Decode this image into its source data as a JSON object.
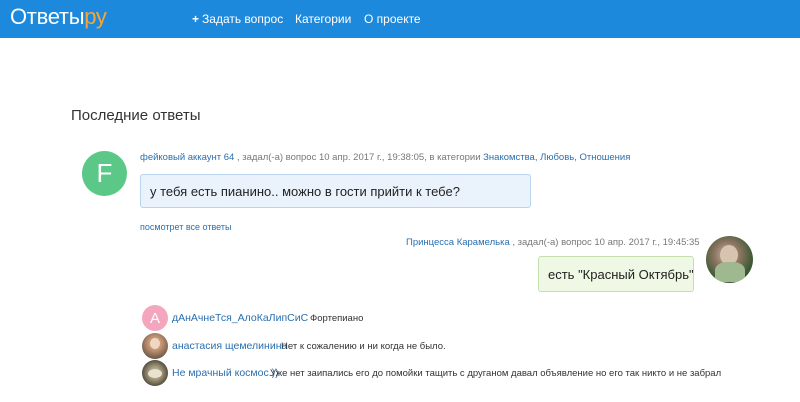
{
  "navbar": {
    "logo_main": "Ответы",
    "logo_accent": "ру",
    "ask_label": "Задать вопрос",
    "categories_label": "Категории",
    "about_label": "О проекте"
  },
  "section_title": "Последние ответы",
  "question": {
    "avatar_letter": "F",
    "author": "фейковый аккаунт 64",
    "meta_text": ", задал(-а) вопрос 10 апр. 2017 г., 19:38:05, в категории",
    "category_1": "Знакомства, Любовь, Отношения",
    "text": "у тебя есть пианино.. можно в гости прийти к тебе?",
    "see_all": "посмотрет все ответы"
  },
  "answer": {
    "author": "Принцесса Карамелька",
    "meta_text": ", задал(-а) вопрос 10 апр. 2017 г., 19:45:35",
    "text": "есть \"Красный Октябрь\""
  },
  "replies": [
    {
      "avatar_letter": "А",
      "user": "дАнАчнеТся_АлоКаЛипСиС",
      "text": "Фортепиано"
    },
    {
      "avatar_letter": "",
      "user": "анастасия щемелинина",
      "text": "Нет к сожалению и ни когда не было."
    },
    {
      "avatar_letter": "",
      "user": "Не мрачный космос.))",
      "text": "Уже нет заипались его до помойки тащить с друганом давал объявление но его так никто и не забрал"
    }
  ],
  "colors": {
    "navbar": "#1d89dd",
    "logo_accent": "#f5a53a",
    "link": "#2a6faf",
    "question_avatar": "#5cc887",
    "reply_avatar_1": "#f4a6bf"
  }
}
